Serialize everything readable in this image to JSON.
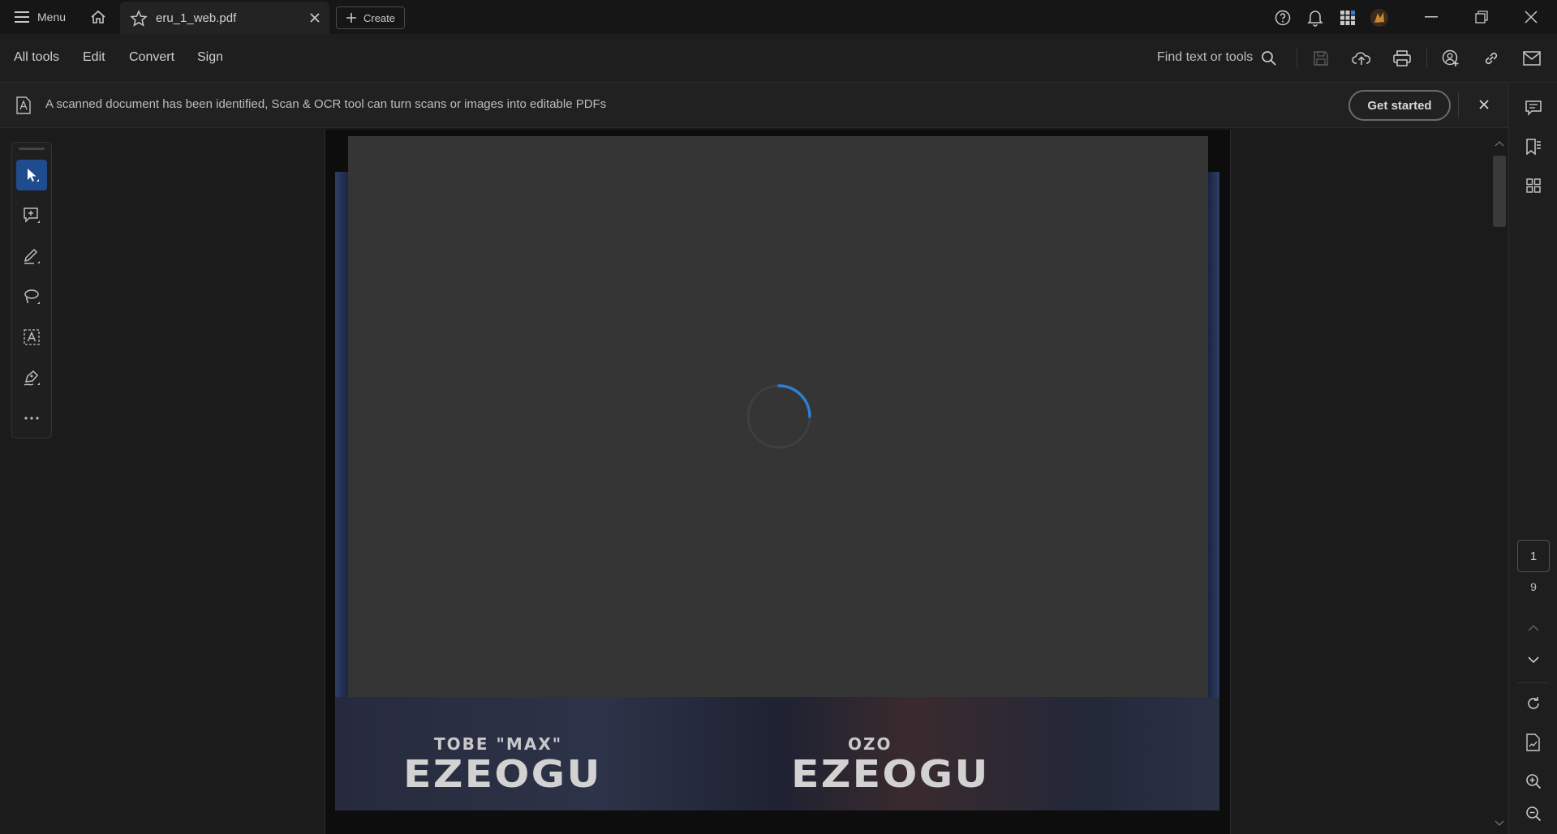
{
  "titlebar": {
    "menu_label": "Menu",
    "tab_title": "eru_1_web.pdf",
    "create_label": "Create"
  },
  "toolbar": {
    "menus": [
      "All tools",
      "Edit",
      "Convert",
      "Sign"
    ],
    "find_label": "Find text or tools"
  },
  "banner": {
    "message": "A scanned document has been identified, Scan & OCR tool can turn scans or images into editable PDFs",
    "cta_label": "Get started"
  },
  "document": {
    "credit_left_small": "TOBE \"MAX\"",
    "credit_left_big": "EZEOGU",
    "credit_right_small": "OZO",
    "credit_right_big": "EZEOGU"
  },
  "pager": {
    "current_page": "1",
    "total_pages": "9"
  },
  "colors": {
    "accent": "#1f4b8f",
    "spinner": "#2d7fd8",
    "background": "#1b1b1b"
  }
}
